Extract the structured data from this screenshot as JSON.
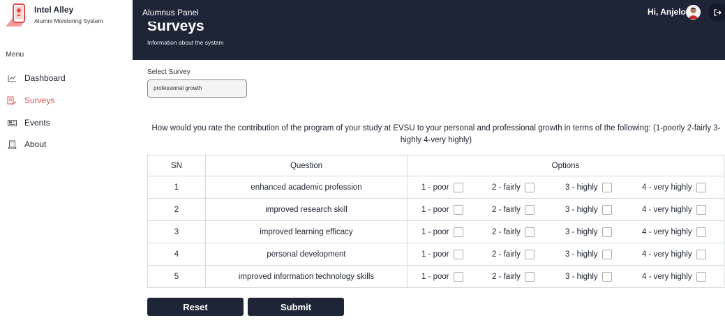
{
  "brand": {
    "name": "Intel Alley",
    "subtitle": "Alumni Monitoring System",
    "logo": "phone-location-logo"
  },
  "sidebar": {
    "menu_heading": "Menu",
    "items": [
      {
        "label": "Dashboard",
        "icon": "chart-line-icon",
        "active": false
      },
      {
        "label": "Surveys",
        "icon": "survey-icon",
        "active": true
      },
      {
        "label": "Events",
        "icon": "newspaper-icon",
        "active": false
      },
      {
        "label": "About",
        "icon": "building-icon",
        "active": false
      }
    ]
  },
  "topbar": {
    "panel_title": "Alumnus Panel",
    "page_title": "Surveys",
    "page_subtitle": "Information about the system",
    "greeting": "Hi, Anjelo",
    "logout_icon": "logout-icon"
  },
  "survey": {
    "select_label": "Select Survey",
    "selected_value": "professional growth",
    "question": "How would you rate the contribution of the program of your study at EVSU to your personal and professional growth in terms of the following: (1-poorly 2-fairly 3-highly 4-very highly)",
    "headers": {
      "sn": "SN",
      "question": "Question",
      "options": "Options"
    },
    "option_labels": [
      "1 - poor",
      "2 - fairly",
      "3 - highly",
      "4 - very highly"
    ],
    "rows": [
      {
        "sn": "1",
        "question": "enhanced academic profession"
      },
      {
        "sn": "2",
        "question": "improved research skill"
      },
      {
        "sn": "3",
        "question": "improved learning efficacy"
      },
      {
        "sn": "4",
        "question": "personal development"
      },
      {
        "sn": "5",
        "question": "improved information technology skills"
      }
    ]
  },
  "buttons": {
    "reset": "Reset",
    "submit": "Submit"
  },
  "colors": {
    "dark": "#1e2536",
    "accent": "#e34b4b",
    "border": "#d6d8dc"
  }
}
